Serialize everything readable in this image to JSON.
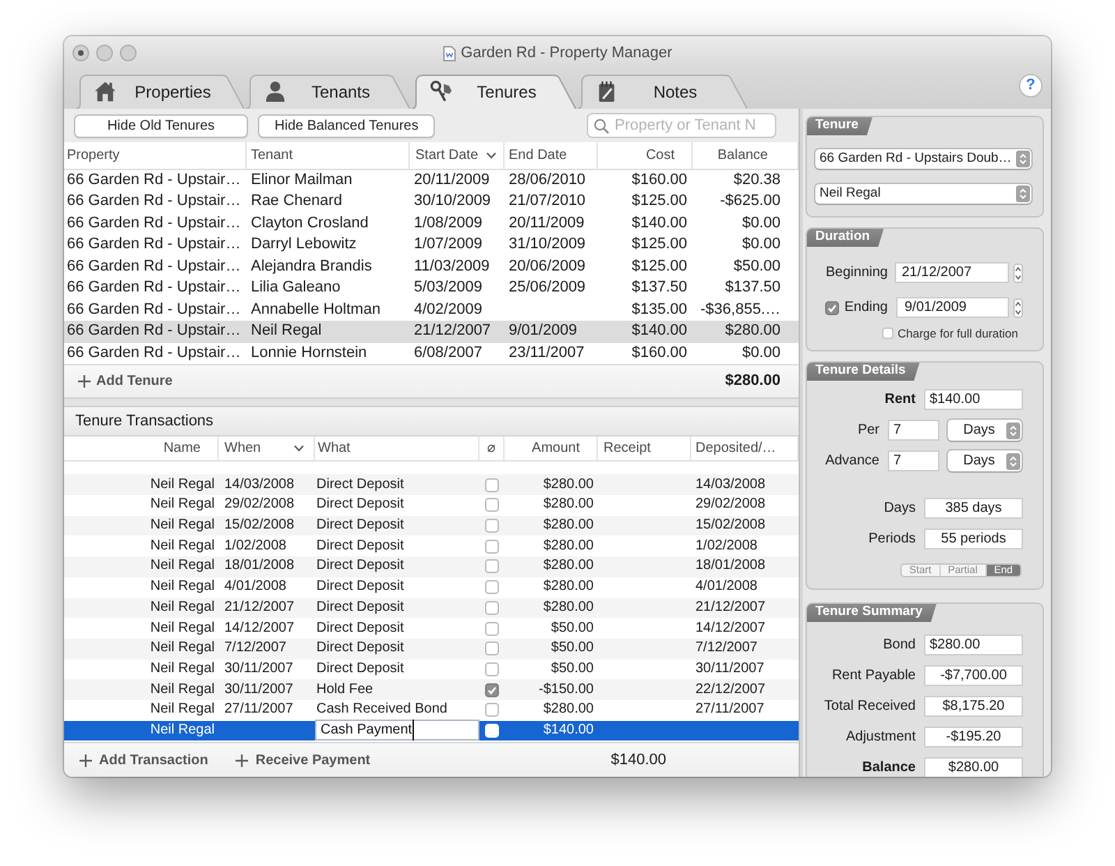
{
  "window": {
    "title": "Garden Rd - Property Manager"
  },
  "tabs": [
    {
      "label": "Properties",
      "selected": false
    },
    {
      "label": "Tenants",
      "selected": false
    },
    {
      "label": "Tenures",
      "selected": true
    },
    {
      "label": "Notes",
      "selected": false
    }
  ],
  "help_button": "?",
  "toolbar": {
    "buttons": [
      "Hide Old Tenures",
      "Hide Balanced Tenures"
    ],
    "search": {
      "placeholder": "Property or Tenant N"
    }
  },
  "tenures": {
    "columns": [
      {
        "label": "Property",
        "sorted": false
      },
      {
        "label": "Tenant",
        "sorted": false
      },
      {
        "label": "Start Date",
        "sorted": true
      },
      {
        "label": "End Date",
        "sorted": false
      },
      {
        "label": "Cost",
        "sorted": false
      },
      {
        "label": "Balance",
        "sorted": false
      }
    ],
    "rows": [
      {
        "property": "66 Garden Rd - Upstair…",
        "tenant": "Elinor Mailman",
        "start_date": "20/11/2009",
        "end_date": "28/06/2010",
        "cost": "$160.00",
        "balance": "$20.38",
        "selected": false
      },
      {
        "property": "66 Garden Rd - Upstair…",
        "tenant": "Rae Chenard",
        "start_date": "30/10/2009",
        "end_date": "21/07/2010",
        "cost": "$125.00",
        "balance": "-$625.00",
        "selected": false
      },
      {
        "property": "66 Garden Rd - Upstair…",
        "tenant": "Clayton Crosland",
        "start_date": "1/08/2009",
        "end_date": "20/11/2009",
        "cost": "$140.00",
        "balance": "$0.00",
        "selected": false
      },
      {
        "property": "66 Garden Rd - Upstair…",
        "tenant": "Darryl Lebowitz",
        "start_date": "1/07/2009",
        "end_date": "31/10/2009",
        "cost": "$125.00",
        "balance": "$0.00",
        "selected": false
      },
      {
        "property": "66 Garden Rd - Upstair…",
        "tenant": "Alejandra Brandis",
        "start_date": "11/03/2009",
        "end_date": "20/06/2009",
        "cost": "$125.00",
        "balance": "$50.00",
        "selected": false
      },
      {
        "property": "66 Garden Rd - Upstair…",
        "tenant": "Lilia Galeano",
        "start_date": "5/03/2009",
        "end_date": "25/06/2009",
        "cost": "$137.50",
        "balance": "$137.50",
        "selected": false
      },
      {
        "property": "66 Garden Rd - Upstair…",
        "tenant": "Annabelle Holtman",
        "start_date": "4/02/2009",
        "cost": "$135.00",
        "balance": "-$36,855.…",
        "selected": false
      },
      {
        "property": "66 Garden Rd - Upstair…",
        "tenant": "Neil Regal",
        "start_date": "21/12/2007",
        "end_date": "9/01/2009",
        "cost": "$140.00",
        "balance": "$280.00",
        "selected": true
      },
      {
        "property": "66 Garden Rd - Upstair…",
        "tenant": "Lonnie Hornstein",
        "start_date": "6/08/2007",
        "end_date": "23/11/2007",
        "cost": "$160.00",
        "balance": "$0.00",
        "selected": false
      }
    ],
    "add_button": "Add Tenure",
    "total": "$280.00"
  },
  "transactions": {
    "title": "Tenure Transactions",
    "columns": [
      {
        "label": "Name",
        "sorted": false
      },
      {
        "label": "When",
        "sorted": true
      },
      {
        "label": "What",
        "sorted": false
      },
      {
        "label": "⌀",
        "sorted": false
      },
      {
        "label": "Amount",
        "sorted": false
      },
      {
        "label": "Receipt",
        "sorted": false
      },
      {
        "label": "Deposited/…",
        "sorted": false
      }
    ],
    "rows": [
      {
        "name": "Neil Regal",
        "when": "14/03/2008",
        "what": "Direct Deposit",
        "checked": false,
        "amount": "$280.00",
        "deposited": "14/03/2008",
        "selected": false
      },
      {
        "name": "Neil Regal",
        "when": "29/02/2008",
        "what": "Direct Deposit",
        "checked": false,
        "amount": "$280.00",
        "deposited": "29/02/2008",
        "selected": false
      },
      {
        "name": "Neil Regal",
        "when": "15/02/2008",
        "what": "Direct Deposit",
        "checked": false,
        "amount": "$280.00",
        "deposited": "15/02/2008",
        "selected": false
      },
      {
        "name": "Neil Regal",
        "when": "1/02/2008",
        "what": "Direct Deposit",
        "checked": false,
        "amount": "$280.00",
        "deposited": "1/02/2008",
        "selected": false
      },
      {
        "name": "Neil Regal",
        "when": "18/01/2008",
        "what": "Direct Deposit",
        "checked": false,
        "amount": "$280.00",
        "deposited": "18/01/2008",
        "selected": false
      },
      {
        "name": "Neil Regal",
        "when": "4/01/2008",
        "what": "Direct Deposit",
        "checked": false,
        "amount": "$280.00",
        "deposited": "4/01/2008",
        "selected": false
      },
      {
        "name": "Neil Regal",
        "when": "21/12/2007",
        "what": "Direct Deposit",
        "checked": false,
        "amount": "$280.00",
        "deposited": "21/12/2007",
        "selected": false
      },
      {
        "name": "Neil Regal",
        "when": "14/12/2007",
        "what": "Direct Deposit",
        "checked": false,
        "amount": "$50.00",
        "deposited": "14/12/2007",
        "selected": false
      },
      {
        "name": "Neil Regal",
        "when": "7/12/2007",
        "what": "Direct Deposit",
        "checked": false,
        "amount": "$50.00",
        "deposited": "7/12/2007",
        "selected": false
      },
      {
        "name": "Neil Regal",
        "when": "30/11/2007",
        "what": "Direct Deposit",
        "checked": false,
        "amount": "$50.00",
        "deposited": "30/11/2007",
        "selected": false
      },
      {
        "name": "Neil Regal",
        "when": "30/11/2007",
        "what": "Hold Fee",
        "checked": true,
        "amount": "-$150.00",
        "deposited": "22/12/2007",
        "selected": false
      },
      {
        "name": "Neil Regal",
        "when": "27/11/2007",
        "what": "Cash Received Bond",
        "checked": false,
        "amount": "$280.00",
        "deposited": "27/11/2007",
        "selected": false
      },
      {
        "name": "Neil Regal",
        "what": "Cash Payment",
        "checked": false,
        "amount": "$140.00",
        "selected": true
      }
    ],
    "actions": [
      "Add Transaction",
      "Receive Payment"
    ],
    "total": "$140.00"
  },
  "tenure": {
    "title": "Tenure",
    "property": "66 Garden Rd - Upstairs Doub…",
    "tenant": "Neil Regal"
  },
  "duration": {
    "title": "Duration",
    "beginning": {
      "label": "Beginning",
      "value": "21/12/2007"
    },
    "ending": {
      "label": "Ending",
      "value": "9/01/2009",
      "checked": true
    },
    "full_duration": {
      "label": "Charge for full duration",
      "checked": false
    }
  },
  "details": {
    "title": "Tenure Details",
    "fields": [
      {
        "kind": "input",
        "label": "Rent",
        "value": "$140.00",
        "bold": true
      },
      {
        "kind": "period",
        "label": "Per",
        "value": "7",
        "unit": "Days",
        "bold": false
      },
      {
        "kind": "period",
        "label": "Advance",
        "value": "7",
        "unit": "Days",
        "bold": false
      },
      {
        "kind": "display",
        "label": "Days",
        "value": "385 days",
        "bold": false
      },
      {
        "kind": "display",
        "label": "Periods",
        "value": "55 periods",
        "bold": false
      }
    ],
    "segments": [
      {
        "label": "Start",
        "selected": false
      },
      {
        "label": "Partial",
        "selected": false
      },
      {
        "label": "End",
        "selected": true
      }
    ]
  },
  "summary": {
    "title": "Tenure Summary",
    "fields": [
      {
        "kind": "input",
        "label": "Bond",
        "value": "$280.00",
        "bold": false
      },
      {
        "kind": "display",
        "label": "Rent Payable",
        "value": "-$7,700.00",
        "bold": false
      },
      {
        "kind": "display",
        "label": "Total Received",
        "value": "$8,175.20",
        "bold": false
      },
      {
        "kind": "display",
        "label": "Adjustment",
        "value": "-$195.20",
        "bold": false
      },
      {
        "kind": "display",
        "label": "Balance",
        "value": "$280.00",
        "bold": true
      }
    ]
  }
}
